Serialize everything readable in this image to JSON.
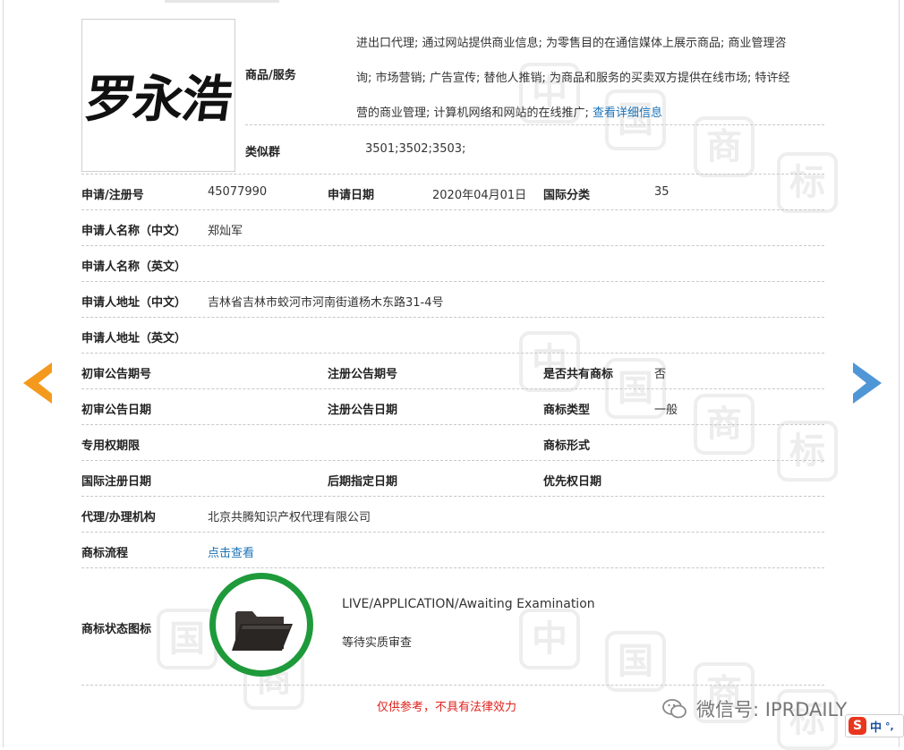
{
  "trademark": {
    "logo_text": "罗永浩",
    "goods_services": {
      "label": "商品/服务",
      "lines": [
        "进出口代理; 通过网站提供商业信息; 为零售目的在通信媒体上展示商品; 商业管理咨",
        "询; 市场营销; 广告宣传; 替他人推销; 为商品和服务的买卖双方提供在线市场; 特许经",
        "营的商业管理; 计算机网络和网站的在线推广;"
      ],
      "detail_link": "查看详细信息"
    },
    "similar_group": {
      "label": "类似群",
      "value": "3501;3502;3503;"
    },
    "fields": {
      "reg_no": {
        "label": "申请/注册号",
        "value": "45077990"
      },
      "app_date": {
        "label": "申请日期",
        "value": "2020年04月01日"
      },
      "intl_class": {
        "label": "国际分类",
        "value": "35"
      },
      "applicant_cn": {
        "label": "申请人名称（中文）",
        "value": "郑灿军"
      },
      "applicant_en": {
        "label": "申请人名称（英文）",
        "value": ""
      },
      "address_cn": {
        "label": "申请人地址（中文）",
        "value": "吉林省吉林市蛟河市河南街道杨木东路31-4号"
      },
      "address_en": {
        "label": "申请人地址（英文）",
        "value": ""
      },
      "prelim_pub_no": {
        "label": "初审公告期号",
        "value": ""
      },
      "reg_pub_no": {
        "label": "注册公告期号",
        "value": ""
      },
      "shared": {
        "label": "是否共有商标",
        "value": "否"
      },
      "prelim_pub_date": {
        "label": "初审公告日期",
        "value": ""
      },
      "reg_pub_date": {
        "label": "注册公告日期",
        "value": ""
      },
      "tm_type": {
        "label": "商标类型",
        "value": "一般"
      },
      "exclusive_period": {
        "label": "专用权期限",
        "value": ""
      },
      "tm_form": {
        "label": "商标形式",
        "value": ""
      },
      "intl_reg_date": {
        "label": "国际注册日期",
        "value": ""
      },
      "later_desig_date": {
        "label": "后期指定日期",
        "value": ""
      },
      "priority_date": {
        "label": "优先权日期",
        "value": ""
      },
      "agent": {
        "label": "代理/办理机构",
        "value": "北京共腾知识产权代理有限公司"
      },
      "process": {
        "label": "商标流程",
        "link": "点击查看"
      }
    },
    "status": {
      "label": "商标状态图标",
      "text_en": "LIVE/APPLICATION/Awaiting Examination",
      "text_cn": "等待实质审查",
      "icon": "folder-icon"
    },
    "disclaimer": "仅供参考，不具有法律效力"
  },
  "watermark": {
    "chars": [
      "中",
      "国",
      "商",
      "标"
    ]
  },
  "wechat_label": "微信号: IPRDAILY",
  "ime": {
    "logo": "S",
    "lang": "中",
    "punct": "°,"
  },
  "colors": {
    "nav_left": "#f39a1e",
    "nav_right": "#4f96d7",
    "status_ring": "#1e9a3b",
    "disclaimer": "#e0211c",
    "link": "#1a73b8"
  }
}
